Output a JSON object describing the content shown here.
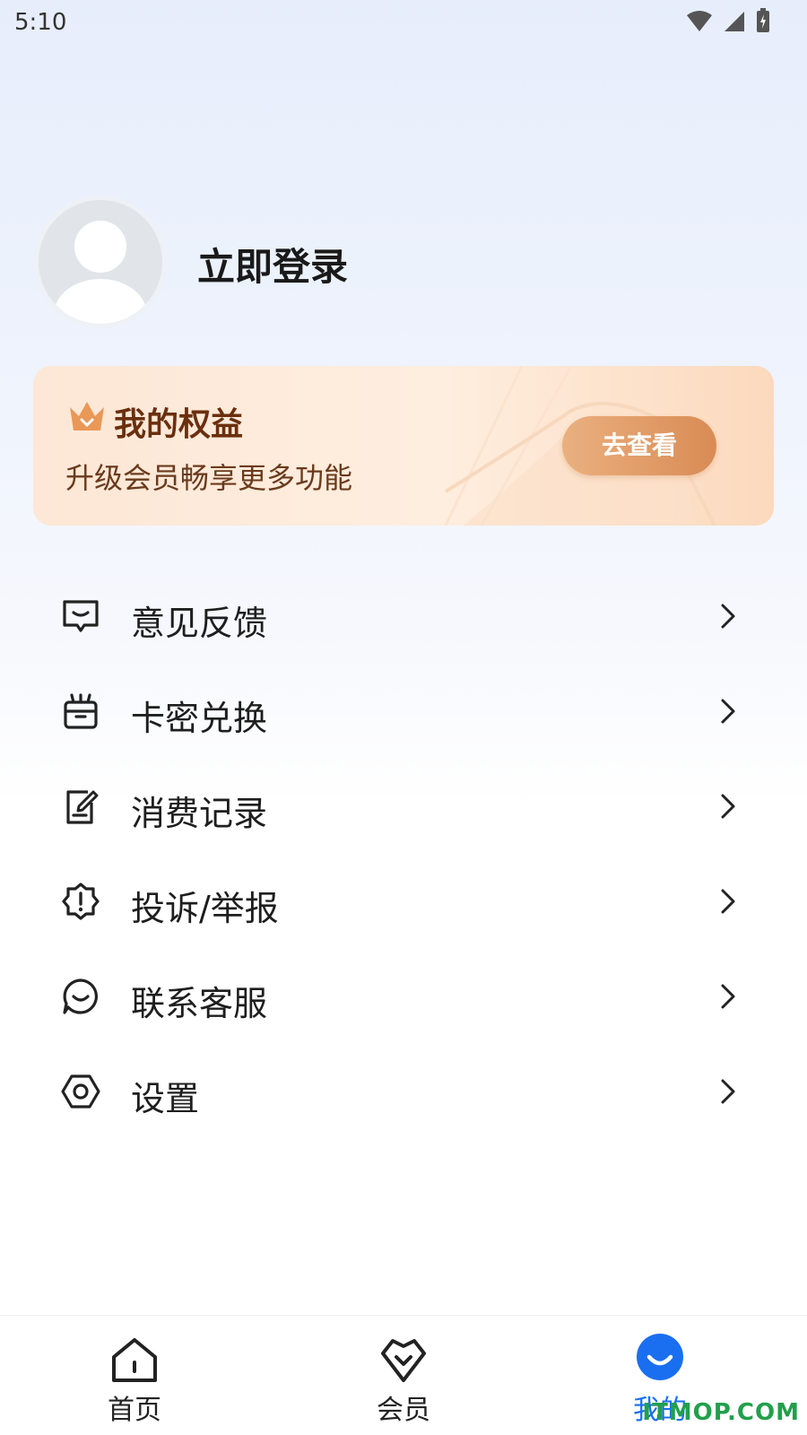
{
  "status_bar": {
    "time": "5:10"
  },
  "profile": {
    "login_label": "立即登录"
  },
  "vip_card": {
    "title": "我的权益",
    "subtitle": "升级会员畅享更多功能",
    "button_label": "去查看",
    "accent_color": "#d98b54"
  },
  "menu": {
    "items": [
      {
        "label": "意见反馈",
        "icon": "feedback-icon"
      },
      {
        "label": "卡密兑换",
        "icon": "gift-icon"
      },
      {
        "label": "消费记录",
        "icon": "record-icon"
      },
      {
        "label": "投诉/举报",
        "icon": "report-icon"
      },
      {
        "label": "联系客服",
        "icon": "service-icon"
      },
      {
        "label": "设置",
        "icon": "settings-icon"
      }
    ]
  },
  "tab_bar": {
    "tabs": [
      {
        "label": "首页",
        "icon": "home-icon"
      },
      {
        "label": "会员",
        "icon": "member-icon"
      },
      {
        "label": "我的",
        "icon": "me-icon"
      }
    ],
    "active_index": 2,
    "active_color": "#1a6ff0"
  },
  "watermark": "ITMOP.COM"
}
